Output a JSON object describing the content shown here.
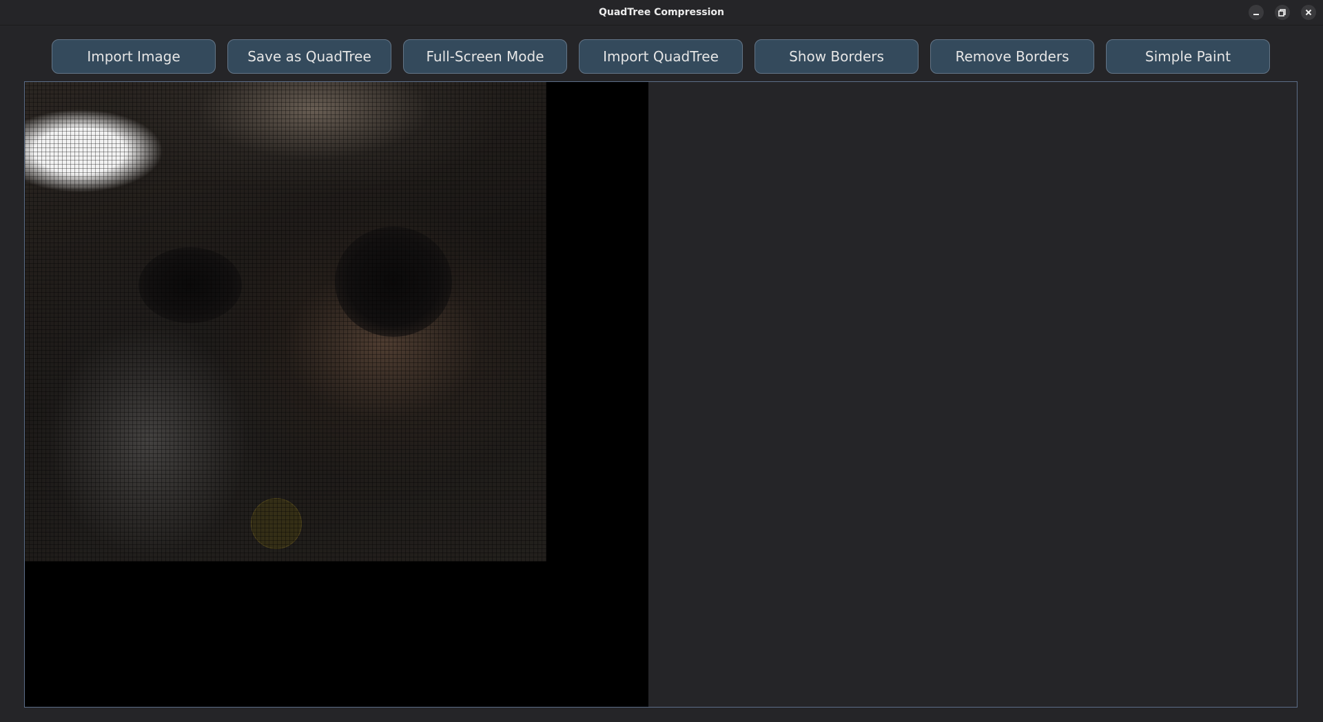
{
  "window": {
    "title": "QuadTree Compression",
    "controls": [
      "minimize-icon",
      "maximize-icon",
      "close-icon"
    ]
  },
  "toolbar": {
    "buttons": [
      {
        "label": "Import Image"
      },
      {
        "label": "Save as QuadTree"
      },
      {
        "label": "Full-Screen Mode"
      },
      {
        "label": "Import QuadTree"
      },
      {
        "label": "Show Borders"
      },
      {
        "label": "Remove Borders"
      },
      {
        "label": "Simple Paint"
      }
    ]
  },
  "colors": {
    "background": "#252528",
    "button_fill": "#344a5c",
    "button_border": "#647688",
    "canvas_border": "#5d6f8a"
  }
}
